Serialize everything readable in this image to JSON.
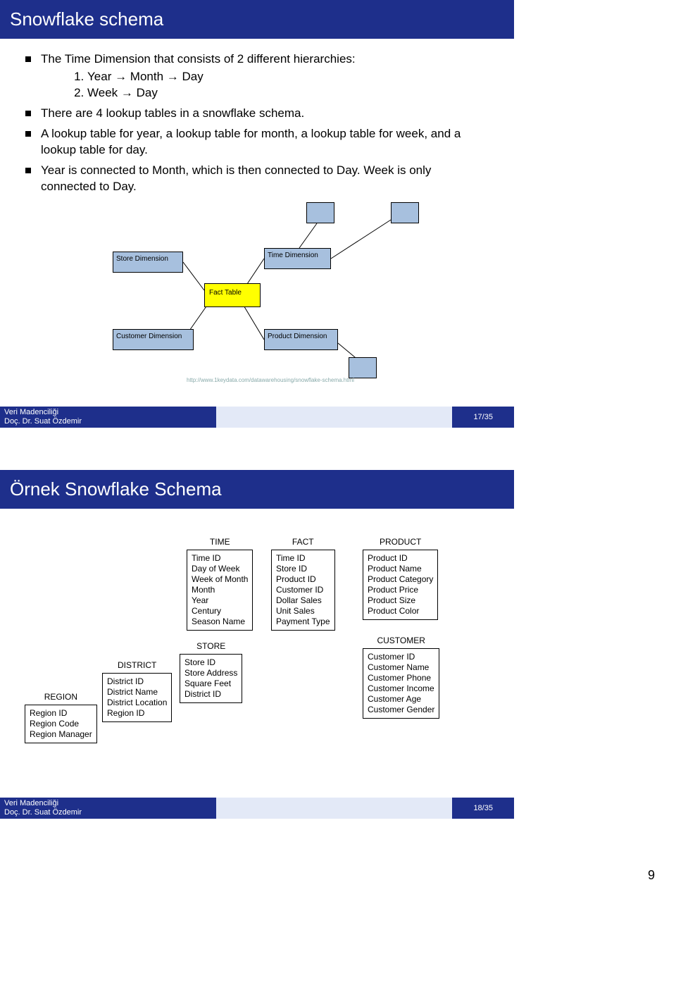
{
  "slide1": {
    "title": "Snowflake schema",
    "bullets": {
      "b1": "The Time Dimension that consists of 2 different hierarchies:",
      "b1_o1": "Year → Month → Day",
      "b1_o2": "Week → Day",
      "b2": "There are 4 lookup tables in a snowflake schema.",
      "b3": "A lookup table for year, a lookup table for month, a lookup table for week, and a lookup table for day.",
      "b4": "Year is connected to Month, which is then connected to Day. Week is only connected to Day."
    },
    "diagram": {
      "store": "Store Dimension",
      "time": "Time Dimension",
      "fact": "Fact Table",
      "customer": "Customer Dimension",
      "product": "Product Dimension",
      "url": "http://www.1keydata.com/datawarehousing/snowflake-schema.html"
    },
    "footer_left1": "Veri Madenciliği",
    "footer_left2": "Doç. Dr. Suat Özdemir",
    "footer_right": "17/35"
  },
  "slide2": {
    "title": "Örnek Snowflake Schema",
    "entities": {
      "time": {
        "title": "TIME",
        "fields": [
          "Time ID",
          "Day of Week",
          "Week of Month",
          "Month",
          "Year",
          "Century",
          "Season Name"
        ]
      },
      "product": {
        "title": "PRODUCT",
        "fields": [
          "Product ID",
          "Product Name",
          "Product Category",
          "Product Price",
          "Product Size",
          "Product Color"
        ]
      },
      "fact": {
        "title": "FACT",
        "fields": [
          "Time ID",
          "Store ID",
          "Product ID",
          "Customer ID",
          "Dollar Sales",
          "Unit Sales",
          "Payment Type"
        ]
      },
      "store": {
        "title": "STORE",
        "fields": [
          "Store ID",
          "Store Address",
          "Square Feet",
          "District ID"
        ]
      },
      "customer": {
        "title": "CUSTOMER",
        "fields": [
          "Customer ID",
          "Customer Name",
          "Customer Phone",
          "Customer Income",
          "Customer Age",
          "Customer Gender"
        ]
      },
      "district": {
        "title": "DISTRICT",
        "fields": [
          "District ID",
          "District Name",
          "District Location",
          "Region ID"
        ]
      },
      "region": {
        "title": "REGION",
        "fields": [
          "Region ID",
          "Region Code",
          "Region Manager"
        ]
      }
    },
    "footer_left1": "Veri Madenciliği",
    "footer_left2": "Doç. Dr. Suat Özdemir",
    "footer_right": "18/35"
  },
  "page_number": "9"
}
